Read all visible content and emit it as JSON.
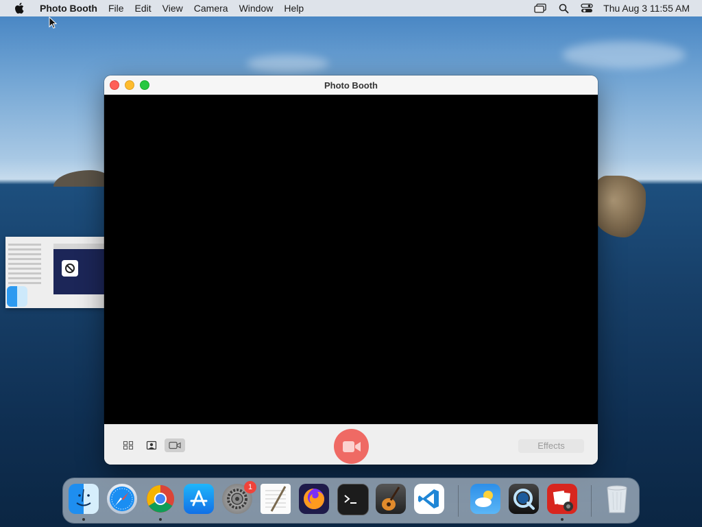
{
  "menubar": {
    "app_name": "Photo Booth",
    "menus": [
      "File",
      "Edit",
      "View",
      "Camera",
      "Window",
      "Help"
    ],
    "clock": "Thu Aug 3  11:55 AM"
  },
  "window": {
    "title": "Photo Booth",
    "effects_label": "Effects"
  },
  "dock": {
    "items": [
      {
        "name": "Finder",
        "icon": "finder-icon",
        "running": true
      },
      {
        "name": "Safari",
        "icon": "safari-icon",
        "running": false
      },
      {
        "name": "Google Chrome",
        "icon": "chrome-icon",
        "running": true
      },
      {
        "name": "App Store",
        "icon": "app-store-icon",
        "running": false
      },
      {
        "name": "System Preferences",
        "icon": "system-preferences-icon",
        "running": false,
        "badge": "1"
      },
      {
        "name": "TextEdit",
        "icon": "textedit-icon",
        "running": false
      },
      {
        "name": "Firefox",
        "icon": "firefox-icon",
        "running": false
      },
      {
        "name": "Terminal",
        "icon": "terminal-icon",
        "running": false
      },
      {
        "name": "GarageBand",
        "icon": "garageband-icon",
        "running": false
      },
      {
        "name": "Visual Studio Code",
        "icon": "vscode-icon",
        "running": false
      },
      {
        "name": "Weather",
        "icon": "weather-icon",
        "running": false
      },
      {
        "name": "QuickTime Player",
        "icon": "quicktime-icon",
        "running": false
      },
      {
        "name": "Photo Booth",
        "icon": "photo-booth-icon",
        "running": true
      },
      {
        "name": "Trash",
        "icon": "trash-icon",
        "running": false
      }
    ]
  },
  "colors": {
    "record": "#ef6a64",
    "close": "#fe5f57",
    "minimize": "#febc2e",
    "zoom": "#28c840"
  }
}
